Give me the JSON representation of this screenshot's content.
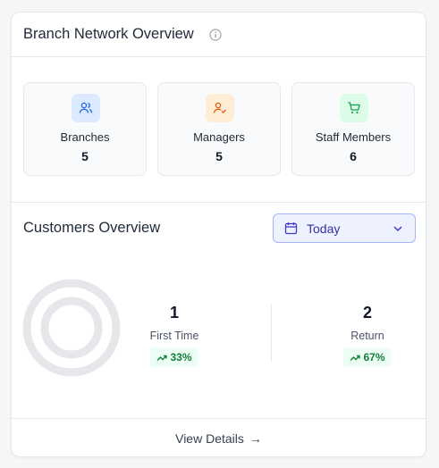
{
  "header": {
    "title": "Branch Network Overview",
    "info_icon": "info-circle-icon"
  },
  "stats": [
    {
      "label": "Branches",
      "value": "5",
      "icon": "users-icon",
      "color": "#2563eb",
      "bg": "#dbeafe"
    },
    {
      "label": "Managers",
      "value": "5",
      "icon": "user-check-icon",
      "color": "#ea580c",
      "bg": "#ffedd5"
    },
    {
      "label": "Staff Members",
      "value": "6",
      "icon": "cart-icon",
      "color": "#16a34a",
      "bg": "#dcfce7"
    }
  ],
  "customers": {
    "title": "Customers Overview",
    "period": {
      "label": "Today",
      "icon": "calendar-icon"
    },
    "first_time": {
      "value": "1",
      "label": "First Time",
      "change": "33%",
      "color": "#0d9488"
    },
    "return": {
      "value": "2",
      "label": "Return",
      "change": "67%",
      "color": "#e05a1c"
    }
  },
  "footer": {
    "link": "View Details",
    "arrow": "→"
  }
}
